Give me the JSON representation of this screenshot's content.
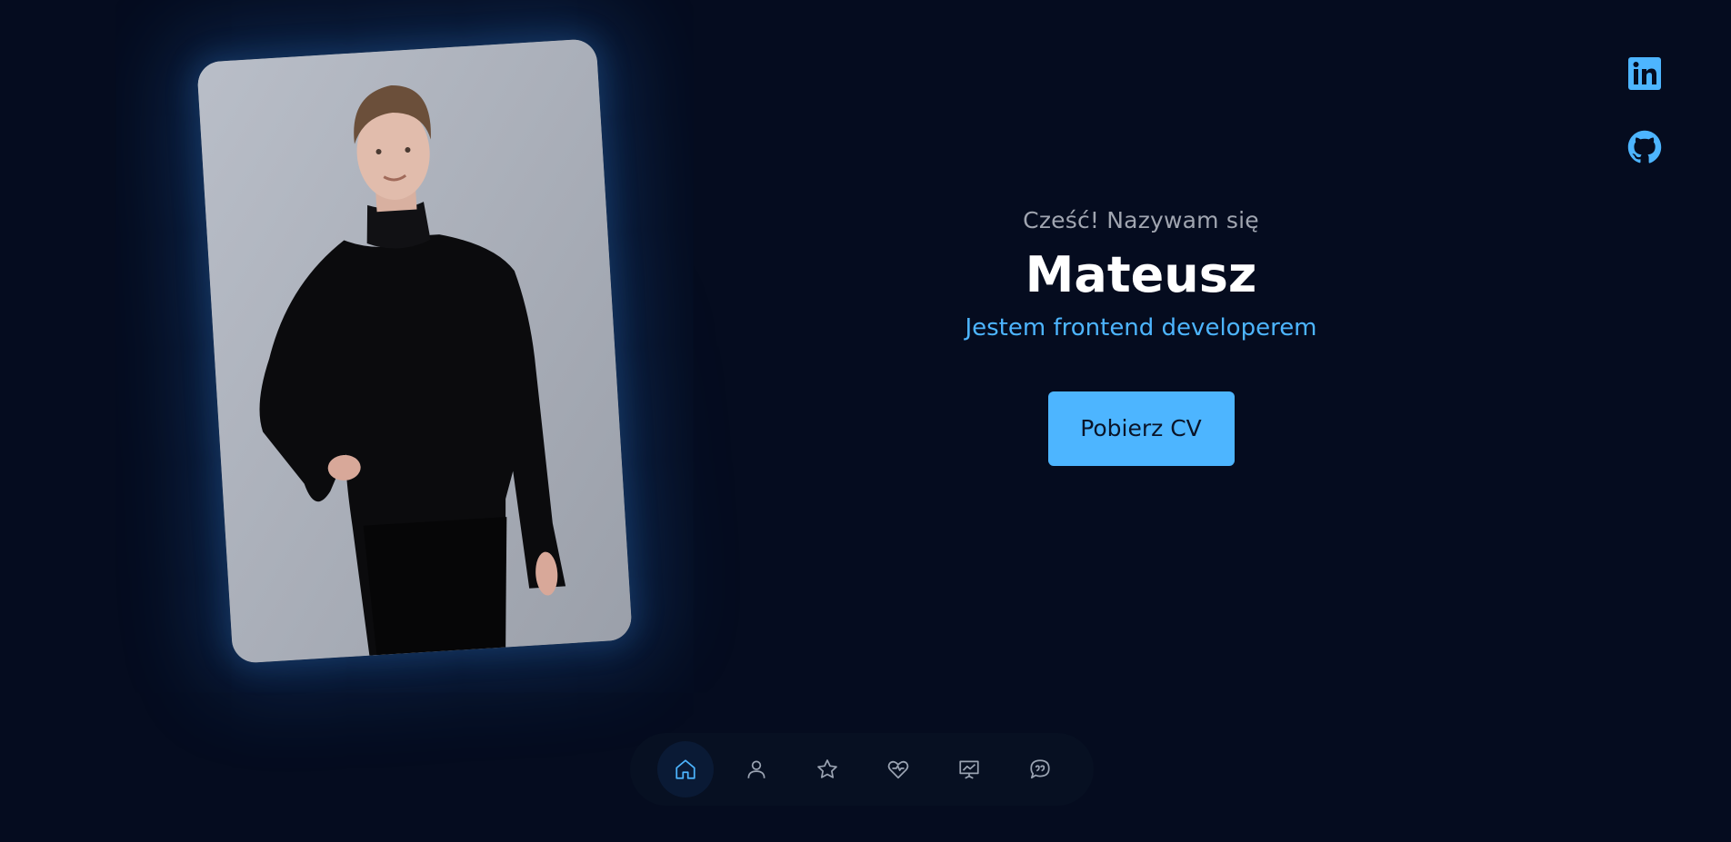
{
  "hero": {
    "greeting": "Cześć! Nazywam się",
    "name": "Mateusz",
    "role": "Jestem frontend developerem",
    "cv_button": "Pobierz CV"
  },
  "portrait": {
    "alt": "Mateusz in a black turtleneck"
  },
  "social": [
    {
      "icon": "linkedin-icon",
      "label": "LinkedIn"
    },
    {
      "icon": "github-icon",
      "label": "GitHub"
    }
  ],
  "nav": {
    "items": [
      {
        "icon": "home-icon",
        "label": "Home",
        "active": true
      },
      {
        "icon": "user-icon",
        "label": "About",
        "active": false
      },
      {
        "icon": "star-icon",
        "label": "Skills",
        "active": false
      },
      {
        "icon": "heart-icon",
        "label": "Interests",
        "active": false
      },
      {
        "icon": "presentation-icon",
        "label": "Projects",
        "active": false
      },
      {
        "icon": "chat-icon",
        "label": "Contact",
        "active": false
      }
    ]
  },
  "colors": {
    "background": "#050c1f",
    "accent": "#4db5ff",
    "heading": "#ffffff",
    "muted": "#a0a5b0",
    "nav_bg": "#071022",
    "nav_icon": "#9aa3b2"
  }
}
